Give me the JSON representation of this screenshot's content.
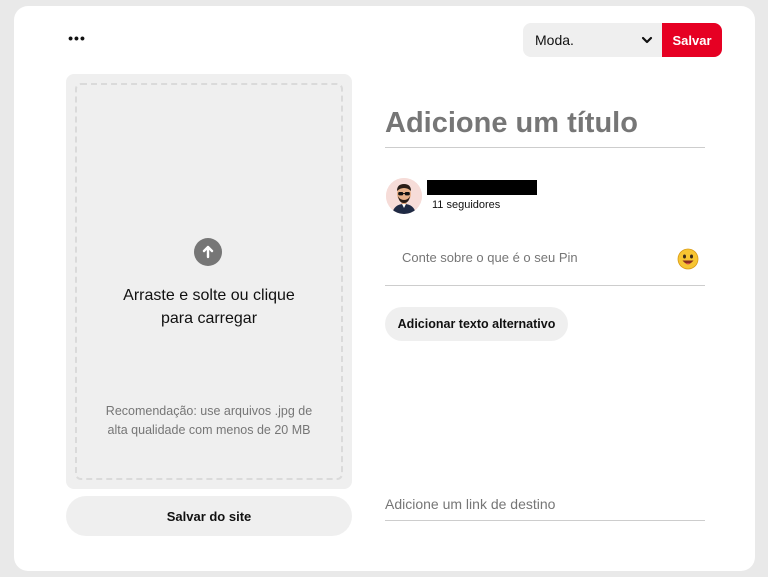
{
  "header": {
    "more_glyph": "•••",
    "board_select": {
      "value": "Moda.",
      "icon": "chevron-down-icon"
    },
    "save_label": "Salvar"
  },
  "upload": {
    "icon": "arrow-up-circle-icon",
    "text_line1": "Arraste e solte ou clique",
    "text_line2": "para carregar",
    "recommendation_line1": "Recomendação: use arquivos .jpg de",
    "recommendation_line2": "alta qualidade com menos de 20 MB"
  },
  "save_from_site_label": "Salvar do site",
  "form": {
    "title_placeholder": "Adicione um título",
    "user": {
      "followers": "11 seguidores"
    },
    "description_placeholder": "Conte sobre o que é o seu Pin",
    "emoji_icon": "smiley-emoji-icon",
    "alt_text_button": "Adicionar texto alternativo",
    "link_placeholder": "Adicione um link de destino"
  },
  "colors": {
    "brand_red": "#e60023",
    "surface_gray": "#efefef",
    "placeholder_gray": "#767676"
  }
}
